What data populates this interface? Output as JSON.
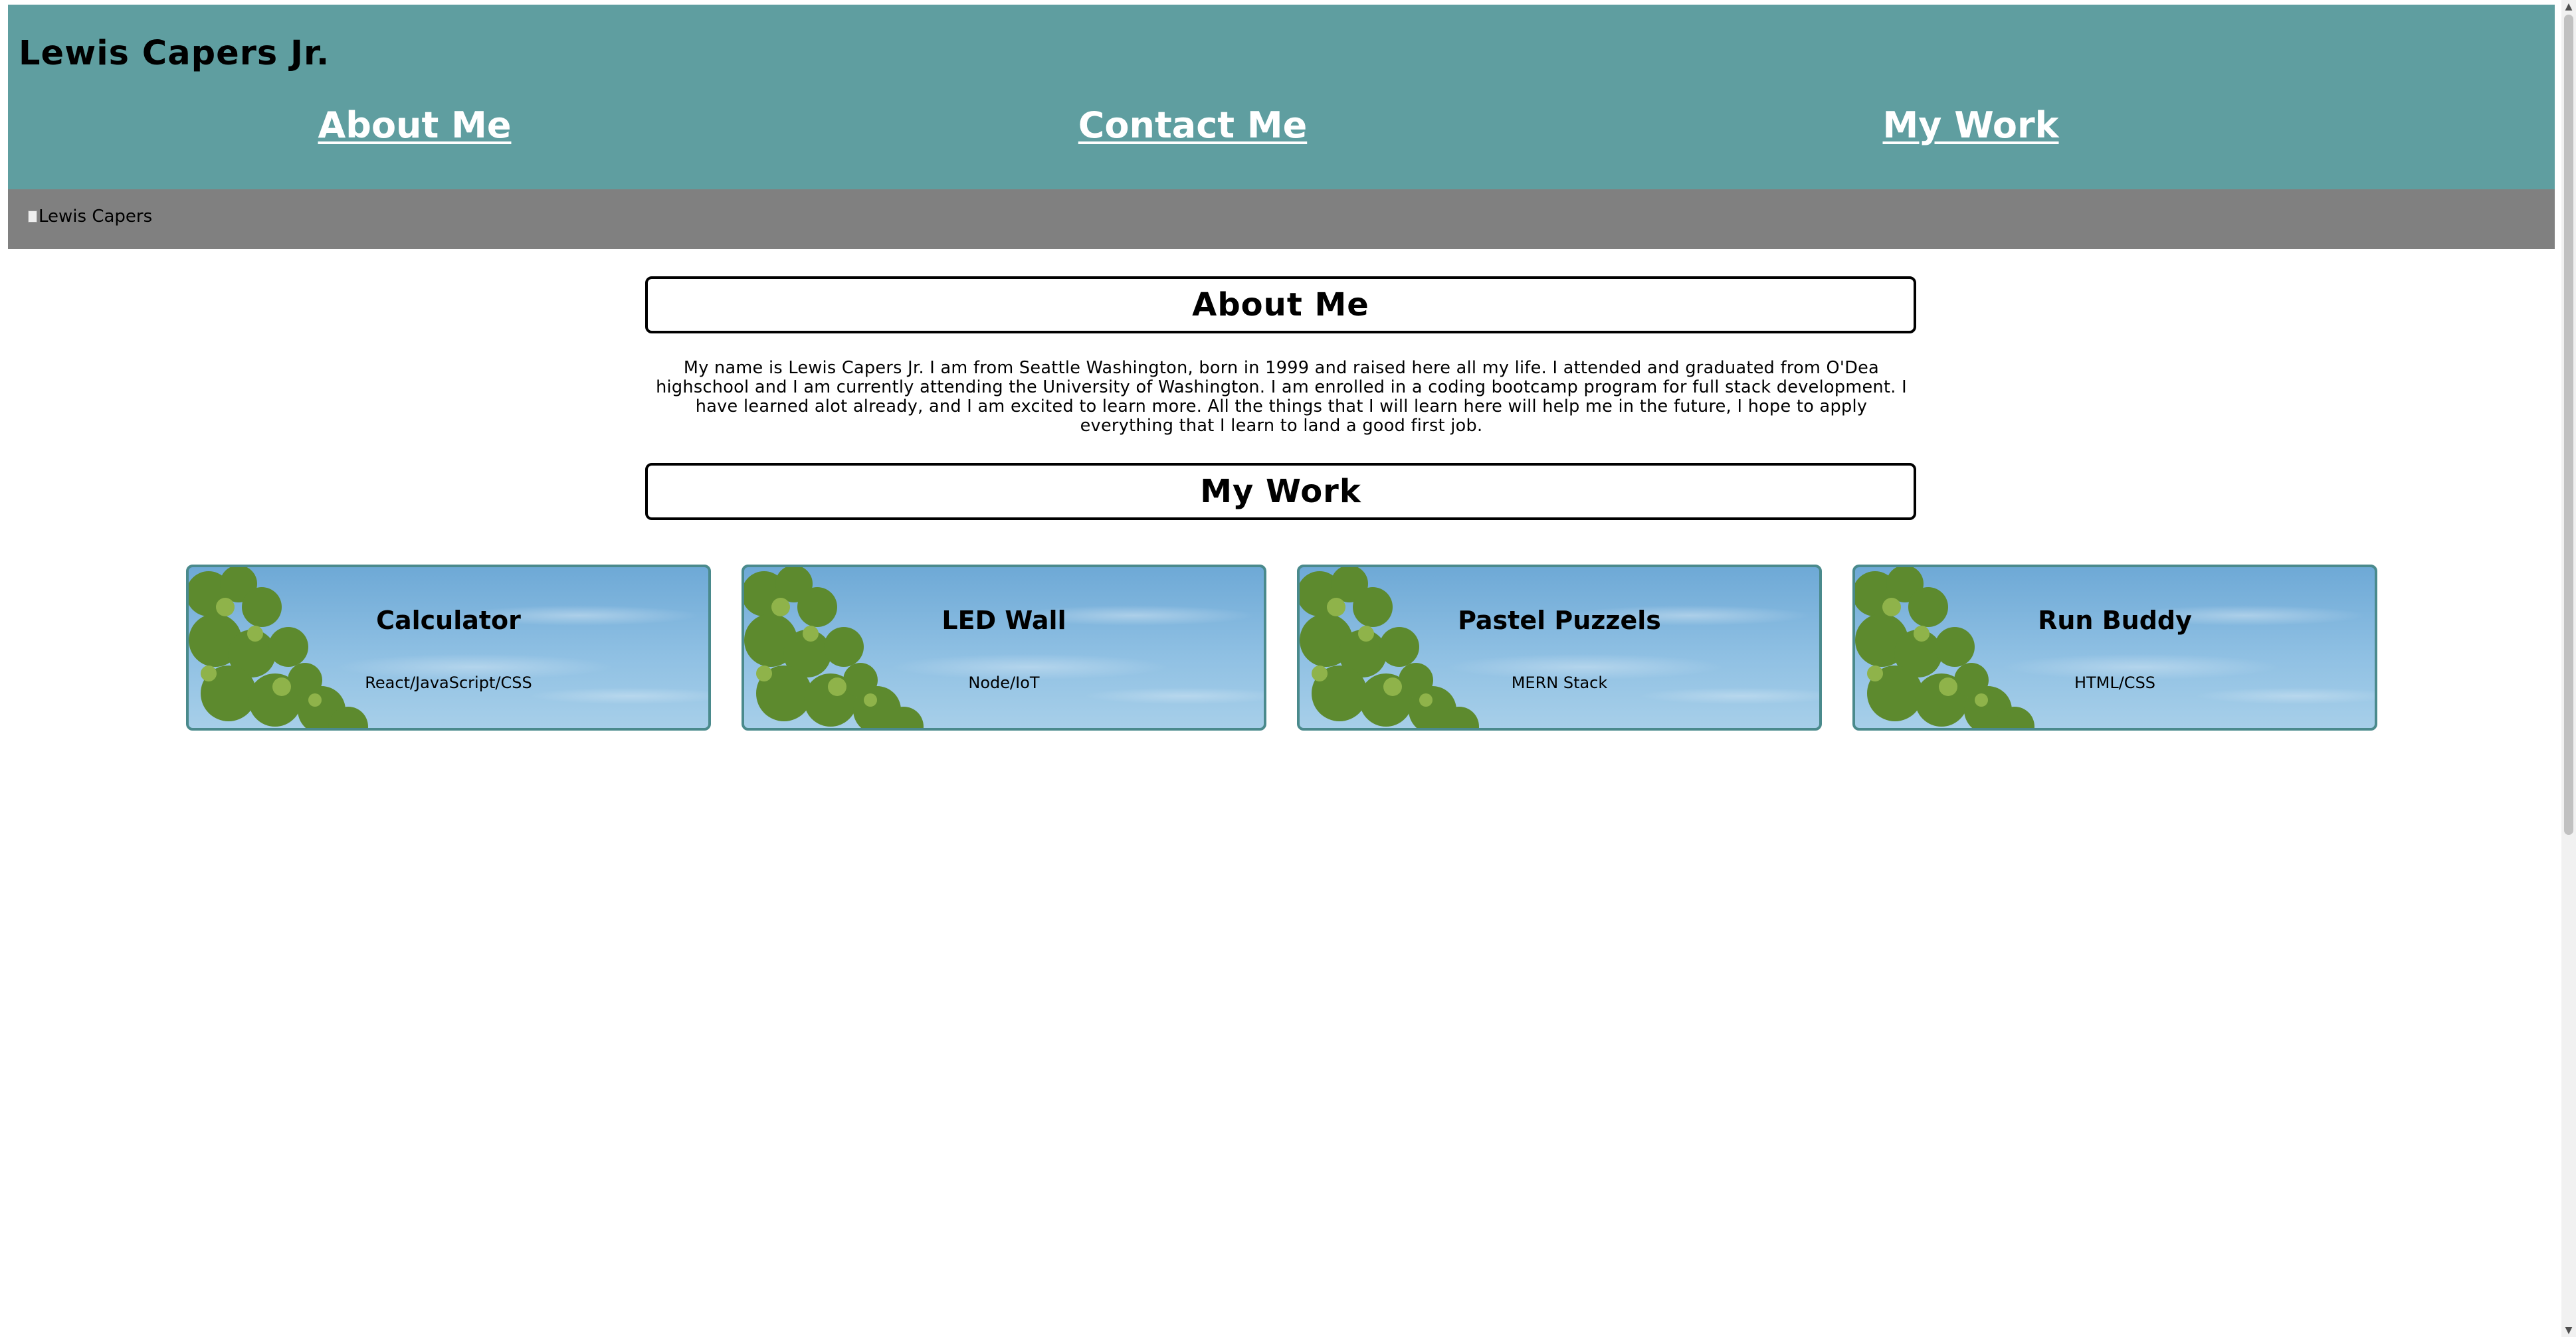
{
  "header": {
    "title": "Lewis Capers Jr.",
    "nav": [
      {
        "label": "About Me"
      },
      {
        "label": "Contact Me"
      },
      {
        "label": "My Work"
      }
    ]
  },
  "hero": {
    "image_alt": "Lewis Capers"
  },
  "about": {
    "heading": "About Me",
    "text": "My name is Lewis Capers Jr. I am from Seattle Washington, born in 1999 and raised here all my life. I attended and graduated from O'Dea highschool and I am currently attending the University of Washington. I am enrolled in a coding bootcamp program for full stack development. I have learned alot already, and I am excited to learn more. All the things that I will learn here will help me in the future, I hope to apply everything that I learn to land a good first job."
  },
  "work": {
    "heading": "My Work",
    "projects": [
      {
        "title": "Calculator",
        "tech": "React/JavaScript/CSS"
      },
      {
        "title": "LED Wall",
        "tech": "Node/IoT"
      },
      {
        "title": "Pastel Puzzels",
        "tech": "MERN Stack"
      },
      {
        "title": "Run Buddy",
        "tech": "HTML/CSS"
      }
    ]
  },
  "colors": {
    "header_bg": "#5f9ea0",
    "hero_bg": "#808080",
    "card_border": "#4a8a8c"
  }
}
